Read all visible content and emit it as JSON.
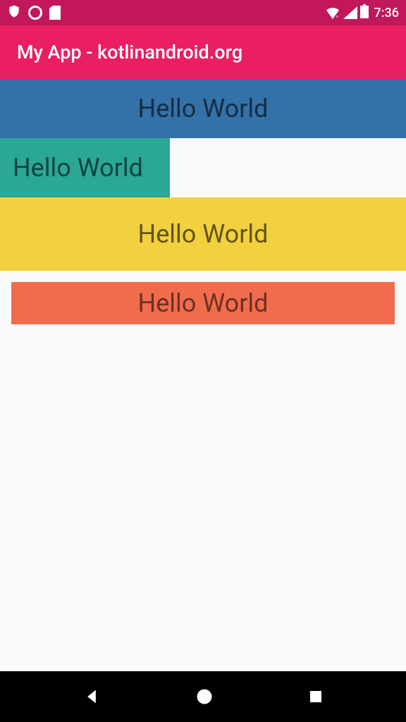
{
  "status_bar": {
    "time": "7:36",
    "icons": {
      "shield": "shield-icon",
      "circle": "circle-outline-icon",
      "sd": "sd-card-icon",
      "wifi": "wifi-icon",
      "signal": "signal-icon",
      "battery": "battery-icon"
    }
  },
  "app_bar": {
    "title": "My App - kotlinandroid.org"
  },
  "rows": [
    {
      "text": "Hello World",
      "color": "#3471a8"
    },
    {
      "text": "Hello World",
      "color": "#2aa895"
    },
    {
      "text": "Hello World",
      "color": "#f2d03e"
    },
    {
      "text": "Hello World",
      "color": "#f16c4d"
    }
  ],
  "nav": {
    "back": "back-button",
    "home": "home-button",
    "recent": "recent-button"
  }
}
